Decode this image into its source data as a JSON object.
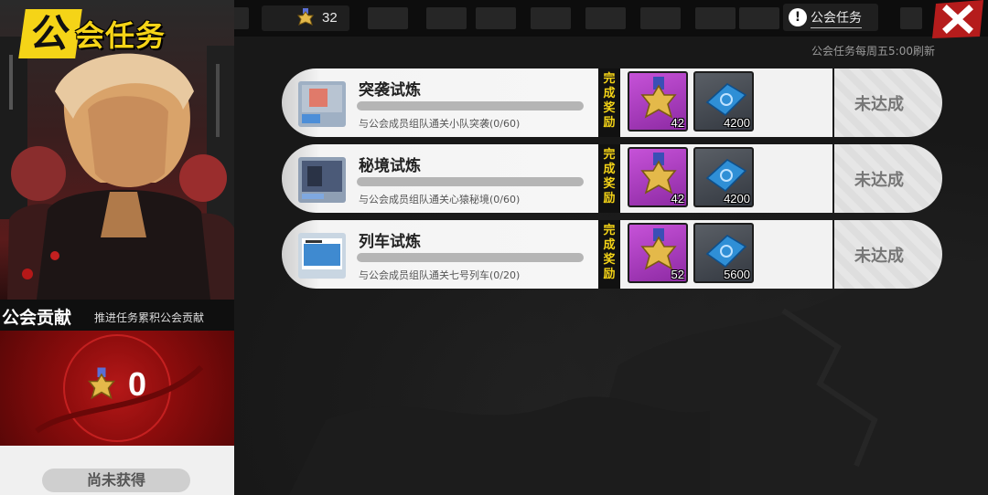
{
  "header": {
    "title": "公会任务",
    "currency_value": "32",
    "guild_task_button": "公会任务",
    "info_glyph": "!"
  },
  "refresh_note": "公会任务每周五5:00刷新",
  "contribution": {
    "title": "公会贡献",
    "subtitle": "推进任务累积公会贡献",
    "value": "0",
    "status": "尚未获得"
  },
  "reward_label": "完成奖励",
  "tasks": [
    {
      "name": "突袭试炼",
      "description": "与公会成员组队通关小队突袭(0/60)",
      "progress": 0,
      "reward_medal_qty": "42",
      "reward_ticket_qty": "4200",
      "status": "未达成"
    },
    {
      "name": "秘境试炼",
      "description": "与公会成员组队通关心猿秘境(0/60)",
      "progress": 0,
      "reward_medal_qty": "42",
      "reward_ticket_qty": "4200",
      "status": "未达成"
    },
    {
      "name": "列车试炼",
      "description": "与公会成员组队通关七号列车(0/20)",
      "progress": 0,
      "reward_medal_qty": "52",
      "reward_ticket_qty": "5600",
      "status": "未达成"
    }
  ],
  "colors": {
    "accent_yellow": "#f5d417",
    "contribution_red": "#a81010",
    "medal_slot_purple": "#b444c8",
    "ticket_blue": "#2f8fd6"
  },
  "icons": [
    "medal-icon",
    "info-icon",
    "close-icon",
    "ticket-icon"
  ]
}
